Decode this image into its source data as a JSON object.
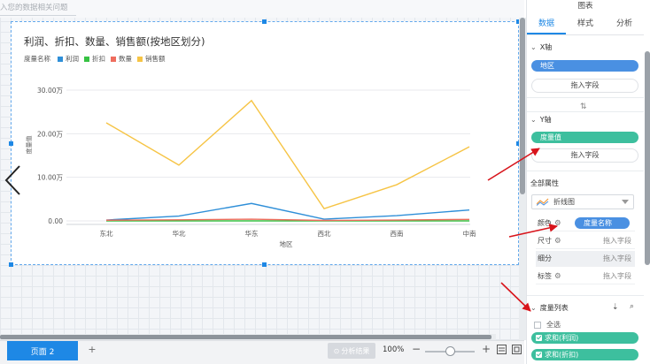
{
  "top_hint": "入您的数据相关问题",
  "chart": {
    "title": "利润、折扣、数量、销售额(按地区划分)",
    "legend_title": "度量名称"
  },
  "chart_data": {
    "type": "line",
    "title": "利润、折扣、数量、销售额(按地区划分)",
    "xlabel": "地区",
    "ylabel": "度量值",
    "categories": [
      "东北",
      "华北",
      "华东",
      "西北",
      "西南",
      "中南"
    ],
    "y_ticks": [
      "0.00",
      "10.00万",
      "20.00万",
      "30.00万"
    ],
    "ylim": [
      0,
      300000
    ],
    "grid": true,
    "legend_position": "top-left",
    "series": [
      {
        "name": "利润",
        "color": "#2f8fd8",
        "values": [
          2000,
          11000,
          40000,
          4000,
          12000,
          25000
        ]
      },
      {
        "name": "折扣",
        "color": "#37c243",
        "values": [
          0,
          0,
          0,
          0,
          0,
          0
        ]
      },
      {
        "name": "数量",
        "color": "#ef6d5e",
        "values": [
          1500,
          2500,
          4000,
          1000,
          1800,
          3500
        ]
      },
      {
        "name": "销售额",
        "color": "#f6c445",
        "values": [
          225000,
          128000,
          276000,
          28000,
          83000,
          170000
        ]
      }
    ]
  },
  "bottom": {
    "page_tab": "页面 2",
    "add_page": "+",
    "analysis_result": "分析结果",
    "zoom": "100%",
    "zoom_minus": "−",
    "zoom_plus": "+"
  },
  "panel": {
    "header": "图表",
    "tabs": [
      "数据",
      "样式",
      "分析"
    ],
    "x_axis": {
      "title": "X轴",
      "field": "地区",
      "drop": "拖入字段"
    },
    "y_axis": {
      "title": "Y轴",
      "field": "度量值",
      "drop": "拖入字段"
    },
    "attributes": {
      "title": "全部属性",
      "chart_type": "折线图",
      "rows": [
        {
          "label": "颜色",
          "value": "度量名称"
        },
        {
          "label": "尺寸",
          "placeholder": "拖入字段"
        },
        {
          "label": "细分",
          "placeholder": "拖入字段"
        },
        {
          "label": "标签",
          "placeholder": "拖入字段"
        }
      ]
    },
    "measures": {
      "title": "度量列表",
      "select_all": "全选",
      "items": [
        "求和(利润)",
        "求和(折扣)"
      ]
    }
  }
}
